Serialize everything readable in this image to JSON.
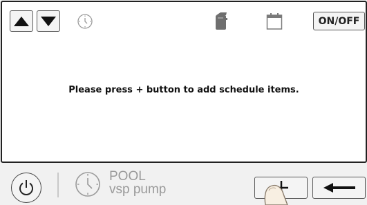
{
  "toolbar": {
    "up_icon": "triangle-up-icon",
    "down_icon": "triangle-down-icon",
    "clock_icon": "clock-icon",
    "device_icon": "pump-device-icon",
    "calendar_icon": "calendar-icon",
    "onoff_label": "ON/OFF"
  },
  "main": {
    "message": "Please press + button to add schedule items."
  },
  "footer": {
    "power_icon": "power-icon",
    "device_clock_icon": "clock-icon",
    "device_line1": "POOL",
    "device_line2": "vsp pump",
    "add_icon": "plus-icon",
    "back_icon": "arrow-left-icon",
    "finger_icon": "fingertip-icon"
  }
}
